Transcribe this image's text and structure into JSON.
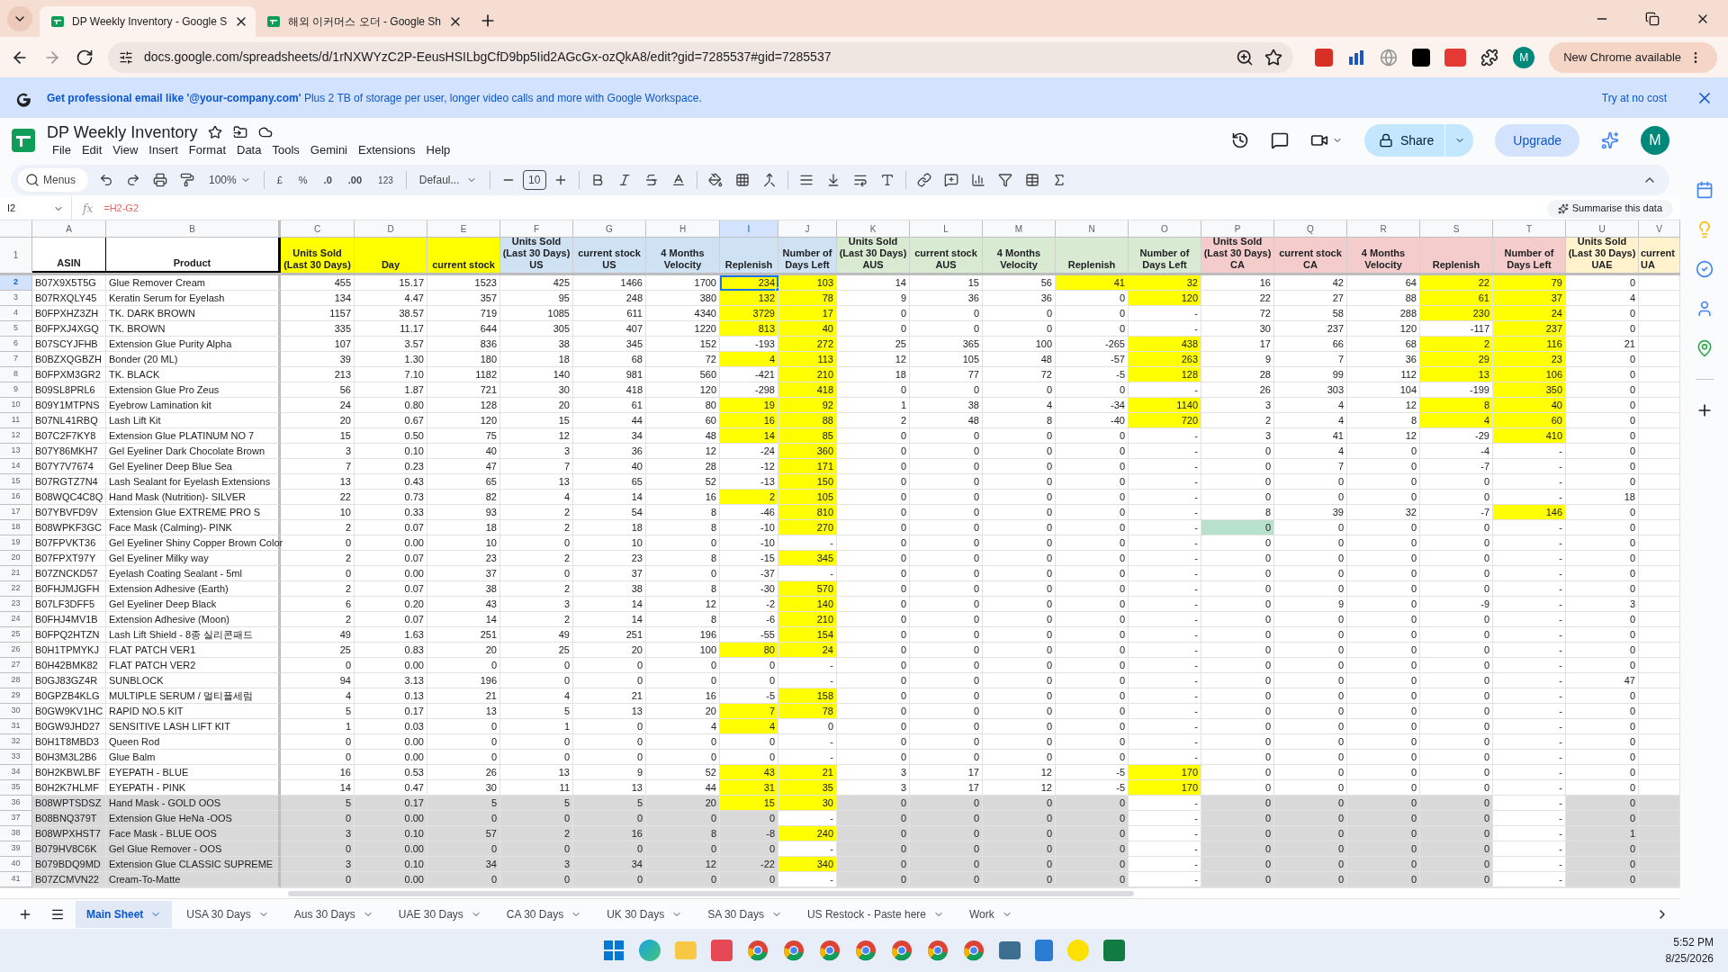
{
  "browser": {
    "tabs": [
      {
        "title": "DP Weekly Inventory - Google S",
        "selected": true
      },
      {
        "title": "해외 이커머스 오더 - Google Sh",
        "selected": false
      }
    ],
    "url": "docs.google.com/spreadsheets/d/1rNXWYzC2P-EeusHSILbgCfD9bp5Iid2AGcGx-ozQkA8/edit?gid=7285537#gid=7285537",
    "profile": "M",
    "update_button": "New Chrome available"
  },
  "banner": {
    "text": "**Get professional email like '@your-company.com'** Plus 2 TB of storage per user, longer video calls and more with Google Workspace.",
    "action": "Try at no cost"
  },
  "doc": {
    "title": "DP Weekly Inventory",
    "menu": [
      "File",
      "Edit",
      "View",
      "Insert",
      "Format",
      "Data",
      "Tools",
      "Gemini",
      "Extensions",
      "Help"
    ],
    "share": "Share",
    "upgrade": "Upgrade",
    "avatar": "M"
  },
  "toolbar": {
    "search": "Menus",
    "zoom": "100%",
    "currency": "£",
    "percent": "%",
    "decrease_decimals": ".0",
    "increase_decimals": ".00",
    "number_format": "123",
    "font": "Defaul...",
    "font_size": "10"
  },
  "formula_bar": {
    "cell": "I2",
    "function_label": "fx",
    "formula": "=H2-G2",
    "summarise": "Summarise this data"
  },
  "columns": [
    {
      "letter": "A",
      "header": "ASIN",
      "kind": "text",
      "color": "#ffffff",
      "selected": false
    },
    {
      "letter": "B",
      "header": "Product",
      "kind": "text",
      "color": "#ffffff",
      "selected": false
    },
    {
      "letter": "C",
      "header": "Units Sold\n(Last 30 Days)",
      "kind": "number",
      "color": "#ffff00",
      "selected": false
    },
    {
      "letter": "D",
      "header": "Day",
      "kind": "number",
      "color": "#ffff00",
      "selected": false
    },
    {
      "letter": "E",
      "header": "current stock",
      "kind": "number",
      "color": "#ffff00",
      "selected": false
    },
    {
      "letter": "F",
      "header": "Units Sold\n(Last 30 Days)\nUS",
      "kind": "number",
      "color": "#cfe2f3",
      "selected": false
    },
    {
      "letter": "G",
      "header": "current stock\nUS",
      "kind": "number",
      "color": "#cfe2f3",
      "selected": false
    },
    {
      "letter": "H",
      "header": "4 Months\nVelocity",
      "kind": "number",
      "color": "#cfe2f3",
      "selected": false
    },
    {
      "letter": "I",
      "header": "Replenish",
      "kind": "number",
      "color": "#cfe2f3",
      "selected": true
    },
    {
      "letter": "J",
      "header": "Number of\nDays Left",
      "kind": "days",
      "color": "#cfe2f3",
      "selected": false
    },
    {
      "letter": "K",
      "header": "Units Sold\n(Last 30 Days)\nAUS",
      "kind": "number",
      "color": "#d9ead3",
      "selected": false
    },
    {
      "letter": "L",
      "header": "current stock\nAUS",
      "kind": "number",
      "color": "#d9ead3",
      "selected": false
    },
    {
      "letter": "M",
      "header": "4 Months\nVelocity",
      "kind": "number",
      "color": "#d9ead3",
      "selected": false
    },
    {
      "letter": "N",
      "header": "Replenish",
      "kind": "number",
      "color": "#d9ead3",
      "selected": false
    },
    {
      "letter": "O",
      "header": "Number of\nDays Left",
      "kind": "days",
      "color": "#d9ead3",
      "selected": false
    },
    {
      "letter": "P",
      "header": "Units Sold\n(Last 30 Days)\nCA",
      "kind": "number",
      "color": "#f4cccc",
      "selected": false
    },
    {
      "letter": "Q",
      "header": "current stock\nCA",
      "kind": "number",
      "color": "#f4cccc",
      "selected": false
    },
    {
      "letter": "R",
      "header": "4 Months\nVelocity",
      "kind": "number",
      "color": "#f4cccc",
      "selected": false
    },
    {
      "letter": "S",
      "header": "Replenish",
      "kind": "number",
      "color": "#f4cccc",
      "selected": false
    },
    {
      "letter": "T",
      "header": "Number of\nDays Left",
      "kind": "days",
      "color": "#f4cccc",
      "selected": false
    },
    {
      "letter": "U",
      "header": "Units Sold\n(Last 30 Days)\nUAE",
      "kind": "number",
      "color": "#fff2cc",
      "selected": false
    },
    {
      "letter": "V",
      "header": "current\nUA",
      "kind": "number",
      "color": "#fff2cc",
      "selected": false
    }
  ],
  "header_row": "1",
  "rows": [
    {
      "n": "2",
      "selected": true,
      "greyed": false,
      "yellow": [
        false,
        false,
        false,
        false,
        false,
        false,
        false,
        false,
        true,
        true,
        false,
        false,
        false,
        true,
        true,
        false,
        false,
        false,
        true,
        true,
        false
      ],
      "cells": [
        "B07X9X5T5G",
        "Glue Remover Cream",
        "455",
        "15.17",
        "1523",
        "425",
        "1466",
        "1700",
        "234",
        "103",
        "14",
        "15",
        "56",
        "41",
        "32",
        "16",
        "42",
        "64",
        "22",
        "79",
        "0"
      ]
    },
    {
      "n": "3",
      "selected": false,
      "greyed": false,
      "yellow": [
        false,
        false,
        false,
        false,
        false,
        false,
        false,
        false,
        true,
        true,
        false,
        false,
        false,
        false,
        true,
        false,
        false,
        false,
        true,
        true,
        false
      ],
      "cells": [
        "B07RXQLY45",
        "Keratin Serum for Eyelash",
        "134",
        "4.47",
        "357",
        "95",
        "248",
        "380",
        "132",
        "78",
        "9",
        "36",
        "36",
        "0",
        "120",
        "22",
        "27",
        "88",
        "61",
        "37",
        "4"
      ]
    },
    {
      "n": "4",
      "selected": false,
      "greyed": false,
      "yellow": [
        false,
        false,
        false,
        false,
        false,
        false,
        false,
        false,
        true,
        true,
        false,
        false,
        false,
        false,
        false,
        false,
        false,
        false,
        true,
        true,
        false
      ],
      "cells": [
        "B0FPXHZ3ZH",
        "TK. DARK BROWN",
        "1157",
        "38.57",
        "719",
        "1085",
        "611",
        "4340",
        "3729",
        "17",
        "0",
        "0",
        "0",
        "0",
        "-",
        "72",
        "58",
        "288",
        "230",
        "24",
        "0"
      ]
    },
    {
      "n": "5",
      "selected": false,
      "greyed": false,
      "yellow": [
        false,
        false,
        false,
        false,
        false,
        false,
        false,
        false,
        true,
        true,
        false,
        false,
        false,
        false,
        false,
        false,
        false,
        false,
        false,
        true,
        false
      ],
      "cells": [
        "B0FPXJ4XGQ",
        "TK. BROWN",
        "335",
        "11.17",
        "644",
        "305",
        "407",
        "1220",
        "813",
        "40",
        "0",
        "0",
        "0",
        "0",
        "-",
        "30",
        "237",
        "120",
        "-117",
        "237",
        "0"
      ]
    },
    {
      "n": "6",
      "selected": false,
      "greyed": false,
      "yellow": [
        false,
        false,
        false,
        false,
        false,
        false,
        false,
        false,
        false,
        true,
        false,
        false,
        false,
        false,
        true,
        false,
        false,
        false,
        true,
        true,
        false
      ],
      "cells": [
        "B07SCYJFHB",
        "Extension Glue Purity Alpha",
        "107",
        "3.57",
        "836",
        "38",
        "345",
        "152",
        "-193",
        "272",
        "25",
        "365",
        "100",
        "-265",
        "438",
        "17",
        "66",
        "68",
        "2",
        "116",
        "21"
      ]
    },
    {
      "n": "7",
      "selected": false,
      "greyed": false,
      "yellow": [
        false,
        false,
        false,
        false,
        false,
        false,
        false,
        false,
        true,
        true,
        false,
        false,
        false,
        false,
        true,
        false,
        false,
        false,
        true,
        true,
        false
      ],
      "cells": [
        "B0BZXQGBZH",
        "Bonder (20 ML)",
        "39",
        "1.30",
        "180",
        "18",
        "68",
        "72",
        "4",
        "113",
        "12",
        "105",
        "48",
        "-57",
        "263",
        "9",
        "7",
        "36",
        "29",
        "23",
        "0"
      ]
    },
    {
      "n": "8",
      "selected": false,
      "greyed": false,
      "yellow": [
        false,
        false,
        false,
        false,
        false,
        false,
        false,
        false,
        false,
        true,
        false,
        false,
        false,
        false,
        true,
        false,
        false,
        false,
        true,
        true,
        false
      ],
      "cells": [
        "B0FPXM3GR2",
        "TK. BLACK",
        "213",
        "7.10",
        "1182",
        "140",
        "981",
        "560",
        "-421",
        "210",
        "18",
        "77",
        "72",
        "-5",
        "128",
        "28",
        "99",
        "112",
        "13",
        "106",
        "0"
      ]
    },
    {
      "n": "9",
      "selected": false,
      "greyed": false,
      "yellow": [
        false,
        false,
        false,
        false,
        false,
        false,
        false,
        false,
        false,
        true,
        false,
        false,
        false,
        false,
        false,
        false,
        false,
        false,
        false,
        true,
        false
      ],
      "cells": [
        "B09SL8PRL6",
        "Extension Glue Pro Zeus",
        "56",
        "1.87",
        "721",
        "30",
        "418",
        "120",
        "-298",
        "418",
        "0",
        "0",
        "0",
        "0",
        "-",
        "26",
        "303",
        "104",
        "-199",
        "350",
        "0"
      ]
    },
    {
      "n": "10",
      "selected": false,
      "greyed": false,
      "yellow": [
        false,
        false,
        false,
        false,
        false,
        false,
        false,
        false,
        true,
        true,
        false,
        false,
        false,
        false,
        true,
        false,
        false,
        false,
        true,
        true,
        false
      ],
      "cells": [
        "B09Y1MTPNS",
        "Eyebrow Lamination kit",
        "24",
        "0.80",
        "128",
        "20",
        "61",
        "80",
        "19",
        "92",
        "1",
        "38",
        "4",
        "-34",
        "1140",
        "3",
        "4",
        "12",
        "8",
        "40",
        "0"
      ]
    },
    {
      "n": "11",
      "selected": false,
      "greyed": false,
      "yellow": [
        false,
        false,
        false,
        false,
        false,
        false,
        false,
        false,
        true,
        true,
        false,
        false,
        false,
        false,
        true,
        false,
        false,
        false,
        true,
        true,
        false
      ],
      "cells": [
        "B07NL41RBQ",
        "Lash Lift Kit",
        "20",
        "0.67",
        "120",
        "15",
        "44",
        "60",
        "16",
        "88",
        "2",
        "48",
        "8",
        "-40",
        "720",
        "2",
        "4",
        "8",
        "4",
        "60",
        "0"
      ]
    },
    {
      "n": "12",
      "selected": false,
      "greyed": false,
      "yellow": [
        false,
        false,
        false,
        false,
        false,
        false,
        false,
        false,
        true,
        true,
        false,
        false,
        false,
        false,
        false,
        false,
        false,
        false,
        false,
        true,
        false
      ],
      "cells": [
        "B07C2F7KY8",
        "Extension Glue PLATINUM NO 7",
        "15",
        "0.50",
        "75",
        "12",
        "34",
        "48",
        "14",
        "85",
        "0",
        "0",
        "0",
        "0",
        "-",
        "3",
        "41",
        "12",
        "-29",
        "410",
        "0"
      ]
    },
    {
      "n": "13",
      "selected": false,
      "greyed": false,
      "yellow": [
        false,
        false,
        false,
        false,
        false,
        false,
        false,
        false,
        false,
        true,
        false,
        false,
        false,
        false,
        false,
        false,
        false,
        false,
        false,
        false,
        false
      ],
      "cells": [
        "B07Y86MKH7",
        "Gel Eyeliner Dark Chocolate Brown",
        "3",
        "0.10",
        "40",
        "3",
        "36",
        "12",
        "-24",
        "360",
        "0",
        "0",
        "0",
        "0",
        "-",
        "0",
        "4",
        "0",
        "-4",
        "-",
        "0"
      ]
    },
    {
      "n": "14",
      "selected": false,
      "greyed": false,
      "yellow": [
        false,
        false,
        false,
        false,
        false,
        false,
        false,
        false,
        false,
        true,
        false,
        false,
        false,
        false,
        false,
        false,
        false,
        false,
        false,
        false,
        false
      ],
      "cells": [
        "B07Y7V7674",
        "Gel Eyeliner Deep Blue Sea",
        "7",
        "0.23",
        "47",
        "7",
        "40",
        "28",
        "-12",
        "171",
        "0",
        "0",
        "0",
        "0",
        "-",
        "0",
        "7",
        "0",
        "-7",
        "-",
        "0"
      ]
    },
    {
      "n": "15",
      "selected": false,
      "greyed": false,
      "yellow": [
        false,
        false,
        false,
        false,
        false,
        false,
        false,
        false,
        false,
        true,
        false,
        false,
        false,
        false,
        false,
        false,
        false,
        false,
        false,
        false,
        false
      ],
      "cells": [
        "B07RGTZ7N4",
        "Lash Sealant for Eyelash Extensions",
        "13",
        "0.43",
        "65",
        "13",
        "65",
        "52",
        "-13",
        "150",
        "0",
        "0",
        "0",
        "0",
        "-",
        "0",
        "0",
        "0",
        "0",
        "-",
        "0"
      ]
    },
    {
      "n": "16",
      "selected": false,
      "greyed": false,
      "yellow": [
        false,
        false,
        false,
        false,
        false,
        false,
        false,
        false,
        true,
        true,
        false,
        false,
        false,
        false,
        false,
        false,
        false,
        false,
        false,
        false,
        false
      ],
      "cells": [
        "B08WQC4C8Q",
        "Hand Mask (Nutrition)- SILVER",
        "22",
        "0.73",
        "82",
        "4",
        "14",
        "16",
        "2",
        "105",
        "0",
        "0",
        "0",
        "0",
        "-",
        "0",
        "0",
        "0",
        "0",
        "-",
        "18"
      ]
    },
    {
      "n": "17",
      "selected": false,
      "greyed": false,
      "yellow": [
        false,
        false,
        false,
        false,
        false,
        false,
        false,
        false,
        false,
        true,
        false,
        false,
        false,
        false,
        false,
        false,
        false,
        false,
        false,
        true,
        false
      ],
      "cells": [
        "B07YBVFD9V",
        "Extension Glue EXTREME PRO S",
        "10",
        "0.33",
        "93",
        "2",
        "54",
        "8",
        "-46",
        "810",
        "0",
        "0",
        "0",
        "0",
        "-",
        "8",
        "39",
        "32",
        "-7",
        "146",
        "0"
      ]
    },
    {
      "n": "18",
      "selected": false,
      "greyed": false,
      "yellow": [
        false,
        false,
        false,
        false,
        false,
        false,
        false,
        false,
        false,
        true,
        false,
        false,
        false,
        false,
        false,
        false,
        false,
        false,
        false,
        false,
        false
      ],
      "green": [
        false,
        false,
        false,
        false,
        false,
        false,
        false,
        false,
        false,
        false,
        false,
        false,
        false,
        false,
        false,
        true,
        false,
        false,
        false,
        false,
        false
      ],
      "cells": [
        "B08WPKF3GC",
        "Face Mask (Calming)- PINK",
        "2",
        "0.07",
        "18",
        "2",
        "18",
        "8",
        "-10",
        "270",
        "0",
        "0",
        "0",
        "0",
        "-",
        "0",
        "0",
        "0",
        "0",
        "-",
        "0"
      ]
    },
    {
      "n": "19",
      "selected": false,
      "greyed": false,
      "yellow": [
        false,
        false,
        false,
        false,
        false,
        false,
        false,
        false,
        false,
        false,
        false,
        false,
        false,
        false,
        false,
        false,
        false,
        false,
        false,
        false,
        false
      ],
      "cells": [
        "B07FPVKT36",
        "Gel Eyeliner Shiny Copper Brown Color",
        "0",
        "0.00",
        "10",
        "0",
        "10",
        "0",
        "-10",
        "-",
        "0",
        "0",
        "0",
        "0",
        "-",
        "0",
        "0",
        "0",
        "0",
        "-",
        "0"
      ]
    },
    {
      "n": "20",
      "selected": false,
      "greyed": false,
      "yellow": [
        false,
        false,
        false,
        false,
        false,
        false,
        false,
        false,
        false,
        true,
        false,
        false,
        false,
        false,
        false,
        false,
        false,
        false,
        false,
        false,
        false
      ],
      "cells": [
        "B07FPXT97Y",
        "Gel Eyeliner Milky way",
        "2",
        "0.07",
        "23",
        "2",
        "23",
        "8",
        "-15",
        "345",
        "0",
        "0",
        "0",
        "0",
        "-",
        "0",
        "0",
        "0",
        "0",
        "-",
        "0"
      ]
    },
    {
      "n": "21",
      "selected": false,
      "greyed": false,
      "yellow": [
        false,
        false,
        false,
        false,
        false,
        false,
        false,
        false,
        false,
        false,
        false,
        false,
        false,
        false,
        false,
        false,
        false,
        false,
        false,
        false,
        false
      ],
      "cells": [
        "B07ZNCKD57",
        "Eyelash Coating Sealant - 5ml",
        "0",
        "0.00",
        "37",
        "0",
        "37",
        "0",
        "-37",
        "-",
        "0",
        "0",
        "0",
        "0",
        "-",
        "0",
        "0",
        "0",
        "0",
        "-",
        "0"
      ]
    },
    {
      "n": "22",
      "selected": false,
      "greyed": false,
      "yellow": [
        false,
        false,
        false,
        false,
        false,
        false,
        false,
        false,
        false,
        true,
        false,
        false,
        false,
        false,
        false,
        false,
        false,
        false,
        false,
        false,
        false
      ],
      "cells": [
        "B0FHJMJGFH",
        "Extension Adhesive (Earth)",
        "2",
        "0.07",
        "38",
        "2",
        "38",
        "8",
        "-30",
        "570",
        "0",
        "0",
        "0",
        "0",
        "-",
        "0",
        "0",
        "0",
        "0",
        "-",
        "0"
      ]
    },
    {
      "n": "23",
      "selected": false,
      "greyed": false,
      "yellow": [
        false,
        false,
        false,
        false,
        false,
        false,
        false,
        false,
        false,
        true,
        false,
        false,
        false,
        false,
        false,
        false,
        false,
        false,
        false,
        false,
        false
      ],
      "cells": [
        "B07LF3DFF5",
        "Gel Eyeliner Deep Black",
        "6",
        "0.20",
        "43",
        "3",
        "14",
        "12",
        "-2",
        "140",
        "0",
        "0",
        "0",
        "0",
        "-",
        "0",
        "9",
        "0",
        "-9",
        "-",
        "3"
      ]
    },
    {
      "n": "24",
      "selected": false,
      "greyed": false,
      "yellow": [
        false,
        false,
        false,
        false,
        false,
        false,
        false,
        false,
        false,
        true,
        false,
        false,
        false,
        false,
        false,
        false,
        false,
        false,
        false,
        false,
        false
      ],
      "cells": [
        "B0FHJ4MV1B",
        "Extension Adhesive (Moon)",
        "2",
        "0.07",
        "14",
        "2",
        "14",
        "8",
        "-6",
        "210",
        "0",
        "0",
        "0",
        "0",
        "-",
        "0",
        "0",
        "0",
        "0",
        "-",
        "0"
      ]
    },
    {
      "n": "25",
      "selected": false,
      "greyed": false,
      "yellow": [
        false,
        false,
        false,
        false,
        false,
        false,
        false,
        false,
        false,
        true,
        false,
        false,
        false,
        false,
        false,
        false,
        false,
        false,
        false,
        false,
        false
      ],
      "cells": [
        "B0FPQ2HTZN",
        "Lash Lift Shield - 8종 실리콘패드",
        "49",
        "1.63",
        "251",
        "49",
        "251",
        "196",
        "-55",
        "154",
        "0",
        "0",
        "0",
        "0",
        "-",
        "0",
        "0",
        "0",
        "0",
        "-",
        "0"
      ]
    },
    {
      "n": "26",
      "selected": false,
      "greyed": false,
      "yellow": [
        false,
        false,
        false,
        false,
        false,
        false,
        false,
        false,
        true,
        true,
        false,
        false,
        false,
        false,
        false,
        false,
        false,
        false,
        false,
        false,
        false
      ],
      "cells": [
        "B0H1TPMYKJ",
        "FLAT PATCH VER1",
        "25",
        "0.83",
        "20",
        "25",
        "20",
        "100",
        "80",
        "24",
        "0",
        "0",
        "0",
        "0",
        "-",
        "0",
        "0",
        "0",
        "0",
        "-",
        "0"
      ]
    },
    {
      "n": "27",
      "selected": false,
      "greyed": false,
      "yellow": [
        false,
        false,
        false,
        false,
        false,
        false,
        false,
        false,
        false,
        false,
        false,
        false,
        false,
        false,
        false,
        false,
        false,
        false,
        false,
        false,
        false
      ],
      "cells": [
        "B0H42BMK82",
        "FLAT PATCH VER2",
        "0",
        "0.00",
        "0",
        "0",
        "0",
        "0",
        "0",
        "-",
        "0",
        "0",
        "0",
        "0",
        "-",
        "0",
        "0",
        "0",
        "0",
        "-",
        "0"
      ]
    },
    {
      "n": "28",
      "selected": false,
      "greyed": false,
      "yellow": [
        false,
        false,
        false,
        false,
        false,
        false,
        false,
        false,
        false,
        false,
        false,
        false,
        false,
        false,
        false,
        false,
        false,
        false,
        false,
        false,
        false
      ],
      "cells": [
        "B0GJ83GZ4R",
        "SUNBLOCK",
        "94",
        "3.13",
        "196",
        "0",
        "0",
        "0",
        "0",
        "-",
        "0",
        "0",
        "0",
        "0",
        "-",
        "0",
        "0",
        "0",
        "0",
        "-",
        "47"
      ]
    },
    {
      "n": "29",
      "selected": false,
      "greyed": false,
      "yellow": [
        false,
        false,
        false,
        false,
        false,
        false,
        false,
        false,
        false,
        true,
        false,
        false,
        false,
        false,
        false,
        false,
        false,
        false,
        false,
        false,
        false
      ],
      "cells": [
        "B0GPZB4KLG",
        "MULTIPLE SERUM / 멀티플세럼",
        "4",
        "0.13",
        "21",
        "4",
        "21",
        "16",
        "-5",
        "158",
        "0",
        "0",
        "0",
        "0",
        "-",
        "0",
        "0",
        "0",
        "0",
        "-",
        "0"
      ]
    },
    {
      "n": "30",
      "selected": false,
      "greyed": false,
      "yellow": [
        false,
        false,
        false,
        false,
        false,
        false,
        false,
        false,
        true,
        true,
        false,
        false,
        false,
        false,
        false,
        false,
        false,
        false,
        false,
        false,
        false
      ],
      "cells": [
        "B0GW9KV1HC",
        "RAPID NO.5 KIT",
        "5",
        "0.17",
        "13",
        "5",
        "13",
        "20",
        "7",
        "78",
        "0",
        "0",
        "0",
        "0",
        "-",
        "0",
        "0",
        "0",
        "0",
        "-",
        "0"
      ]
    },
    {
      "n": "31",
      "selected": false,
      "greyed": false,
      "yellow": [
        false,
        false,
        false,
        false,
        false,
        false,
        false,
        false,
        true,
        false,
        false,
        false,
        false,
        false,
        false,
        false,
        false,
        false,
        false,
        false,
        false
      ],
      "cells": [
        "B0GW9JHD27",
        "SENSITIVE LASH LIFT KIT",
        "1",
        "0.03",
        "0",
        "1",
        "0",
        "4",
        "4",
        "0",
        "0",
        "0",
        "0",
        "0",
        "-",
        "0",
        "0",
        "0",
        "0",
        "-",
        "0"
      ]
    },
    {
      "n": "32",
      "selected": false,
      "greyed": false,
      "yellow": [
        false,
        false,
        false,
        false,
        false,
        false,
        false,
        false,
        false,
        false,
        false,
        false,
        false,
        false,
        false,
        false,
        false,
        false,
        false,
        false,
        false
      ],
      "cells": [
        "B0H1T8MBD3",
        "Queen Rod",
        "0",
        "0.00",
        "0",
        "0",
        "0",
        "0",
        "0",
        "-",
        "0",
        "0",
        "0",
        "0",
        "-",
        "0",
        "0",
        "0",
        "0",
        "-",
        "0"
      ]
    },
    {
      "n": "33",
      "selected": false,
      "greyed": false,
      "yellow": [
        false,
        false,
        false,
        false,
        false,
        false,
        false,
        false,
        false,
        false,
        false,
        false,
        false,
        false,
        false,
        false,
        false,
        false,
        false,
        false,
        false
      ],
      "cells": [
        "B0H3M3L2B6",
        "Glue Balm",
        "0",
        "0.00",
        "0",
        "0",
        "0",
        "0",
        "0",
        "-",
        "0",
        "0",
        "0",
        "0",
        "-",
        "0",
        "0",
        "0",
        "0",
        "-",
        "0"
      ]
    },
    {
      "n": "34",
      "selected": false,
      "greyed": false,
      "yellow": [
        false,
        false,
        false,
        false,
        false,
        false,
        false,
        false,
        true,
        true,
        false,
        false,
        false,
        false,
        true,
        false,
        false,
        false,
        false,
        false,
        false
      ],
      "cells": [
        "B0H2KBWLBF",
        "EYEPATH - BLUE",
        "16",
        "0.53",
        "26",
        "13",
        "9",
        "52",
        "43",
        "21",
        "3",
        "17",
        "12",
        "-5",
        "170",
        "0",
        "0",
        "0",
        "0",
        "-",
        "0"
      ]
    },
    {
      "n": "35",
      "selected": false,
      "greyed": false,
      "yellow": [
        false,
        false,
        false,
        false,
        false,
        false,
        false,
        false,
        true,
        true,
        false,
        false,
        false,
        false,
        true,
        false,
        false,
        false,
        false,
        false,
        false
      ],
      "cells": [
        "B0H2K7HLMF",
        "EYEPATH - PINK",
        "14",
        "0.47",
        "30",
        "11",
        "13",
        "44",
        "31",
        "35",
        "3",
        "17",
        "12",
        "-5",
        "170",
        "0",
        "0",
        "0",
        "0",
        "-",
        "0"
      ]
    },
    {
      "n": "36",
      "selected": false,
      "greyed": true,
      "yellow": [
        false,
        false,
        false,
        false,
        false,
        false,
        false,
        false,
        true,
        true,
        false,
        false,
        false,
        false,
        false,
        false,
        false,
        false,
        false,
        false,
        false
      ],
      "cells": [
        "B08WPTSDSZ",
        "Hand Mask - GOLD OOS",
        "5",
        "0.17",
        "5",
        "5",
        "5",
        "20",
        "15",
        "30",
        "0",
        "0",
        "0",
        "0",
        "-",
        "0",
        "0",
        "0",
        "0",
        "-",
        "0"
      ]
    },
    {
      "n": "37",
      "selected": false,
      "greyed": true,
      "yellow": [
        false,
        false,
        false,
        false,
        false,
        false,
        false,
        false,
        false,
        false,
        false,
        false,
        false,
        false,
        false,
        false,
        false,
        false,
        false,
        false,
        false
      ],
      "cells": [
        "B08BNQ379T",
        "Extension Glue HeNa -OOS",
        "0",
        "0.00",
        "0",
        "0",
        "0",
        "0",
        "0",
        "-",
        "0",
        "0",
        "0",
        "0",
        "-",
        "0",
        "0",
        "0",
        "0",
        "-",
        "0"
      ]
    },
    {
      "n": "38",
      "selected": false,
      "greyed": true,
      "yellow": [
        false,
        false,
        false,
        false,
        false,
        false,
        false,
        false,
        false,
        true,
        false,
        false,
        false,
        false,
        false,
        false,
        false,
        false,
        false,
        false,
        false
      ],
      "cells": [
        "B08WPXHST7",
        "Face Mask - BLUE OOS",
        "3",
        "0.10",
        "57",
        "2",
        "16",
        "8",
        "-8",
        "240",
        "0",
        "0",
        "0",
        "0",
        "-",
        "0",
        "0",
        "0",
        "0",
        "-",
        "1"
      ]
    },
    {
      "n": "39",
      "selected": false,
      "greyed": true,
      "yellow": [
        false,
        false,
        false,
        false,
        false,
        false,
        false,
        false,
        false,
        false,
        false,
        false,
        false,
        false,
        false,
        false,
        false,
        false,
        false,
        false,
        false
      ],
      "cells": [
        "B079HV8C6K",
        "Gel Glue Remover - OOS",
        "0",
        "0.00",
        "0",
        "0",
        "0",
        "0",
        "0",
        "-",
        "0",
        "0",
        "0",
        "0",
        "-",
        "0",
        "0",
        "0",
        "0",
        "-",
        "0"
      ]
    },
    {
      "n": "40",
      "selected": false,
      "greyed": true,
      "yellow": [
        false,
        false,
        false,
        false,
        false,
        false,
        false,
        false,
        false,
        true,
        false,
        false,
        false,
        false,
        false,
        false,
        false,
        false,
        false,
        false,
        false
      ],
      "cells": [
        "B079BDQ9MD",
        "Extension Glue  CLASSIC SUPREME",
        "3",
        "0.10",
        "34",
        "3",
        "34",
        "12",
        "-22",
        "340",
        "0",
        "0",
        "0",
        "0",
        "-",
        "0",
        "0",
        "0",
        "0",
        "-",
        "0"
      ]
    },
    {
      "n": "41",
      "selected": false,
      "greyed": true,
      "yellow": [
        false,
        false,
        false,
        false,
        false,
        false,
        false,
        false,
        false,
        false,
        false,
        false,
        false,
        false,
        false,
        false,
        false,
        false,
        false,
        false,
        false
      ],
      "cells": [
        "B07ZCMVN22",
        "Cream-To-Matte",
        "0",
        "0.00",
        "0",
        "0",
        "0",
        "0",
        "0",
        "-",
        "0",
        "0",
        "0",
        "0",
        "-",
        "0",
        "0",
        "0",
        "0",
        "-",
        "0"
      ]
    }
  ],
  "sheet_tabs": [
    {
      "label": "Main Sheet",
      "selected": true
    },
    {
      "label": "USA 30 Days",
      "selected": false
    },
    {
      "label": "Aus 30 Days",
      "selected": false
    },
    {
      "label": "UAE 30 Days",
      "selected": false
    },
    {
      "label": "CA 30 Days",
      "selected": false
    },
    {
      "label": "UK 30 Days",
      "selected": false
    },
    {
      "label": "SA 30 Days",
      "selected": false
    },
    {
      "label": "US Restock - Paste here",
      "selected": false
    },
    {
      "label": "Work",
      "selected": false
    }
  ],
  "taskbar": {
    "time": "5:52 PM",
    "date": "8/25/2026"
  }
}
